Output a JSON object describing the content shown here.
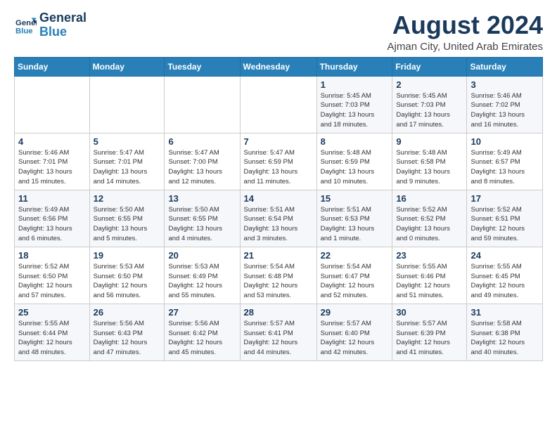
{
  "logo": {
    "line1": "General",
    "line2": "Blue"
  },
  "title": "August 2024",
  "location": "Ajman City, United Arab Emirates",
  "weekdays": [
    "Sunday",
    "Monday",
    "Tuesday",
    "Wednesday",
    "Thursday",
    "Friday",
    "Saturday"
  ],
  "weeks": [
    [
      {
        "day": "",
        "detail": ""
      },
      {
        "day": "",
        "detail": ""
      },
      {
        "day": "",
        "detail": ""
      },
      {
        "day": "",
        "detail": ""
      },
      {
        "day": "1",
        "detail": "Sunrise: 5:45 AM\nSunset: 7:03 PM\nDaylight: 13 hours\nand 18 minutes."
      },
      {
        "day": "2",
        "detail": "Sunrise: 5:45 AM\nSunset: 7:03 PM\nDaylight: 13 hours\nand 17 minutes."
      },
      {
        "day": "3",
        "detail": "Sunrise: 5:46 AM\nSunset: 7:02 PM\nDaylight: 13 hours\nand 16 minutes."
      }
    ],
    [
      {
        "day": "4",
        "detail": "Sunrise: 5:46 AM\nSunset: 7:01 PM\nDaylight: 13 hours\nand 15 minutes."
      },
      {
        "day": "5",
        "detail": "Sunrise: 5:47 AM\nSunset: 7:01 PM\nDaylight: 13 hours\nand 14 minutes."
      },
      {
        "day": "6",
        "detail": "Sunrise: 5:47 AM\nSunset: 7:00 PM\nDaylight: 13 hours\nand 12 minutes."
      },
      {
        "day": "7",
        "detail": "Sunrise: 5:47 AM\nSunset: 6:59 PM\nDaylight: 13 hours\nand 11 minutes."
      },
      {
        "day": "8",
        "detail": "Sunrise: 5:48 AM\nSunset: 6:59 PM\nDaylight: 13 hours\nand 10 minutes."
      },
      {
        "day": "9",
        "detail": "Sunrise: 5:48 AM\nSunset: 6:58 PM\nDaylight: 13 hours\nand 9 minutes."
      },
      {
        "day": "10",
        "detail": "Sunrise: 5:49 AM\nSunset: 6:57 PM\nDaylight: 13 hours\nand 8 minutes."
      }
    ],
    [
      {
        "day": "11",
        "detail": "Sunrise: 5:49 AM\nSunset: 6:56 PM\nDaylight: 13 hours\nand 6 minutes."
      },
      {
        "day": "12",
        "detail": "Sunrise: 5:50 AM\nSunset: 6:55 PM\nDaylight: 13 hours\nand 5 minutes."
      },
      {
        "day": "13",
        "detail": "Sunrise: 5:50 AM\nSunset: 6:55 PM\nDaylight: 13 hours\nand 4 minutes."
      },
      {
        "day": "14",
        "detail": "Sunrise: 5:51 AM\nSunset: 6:54 PM\nDaylight: 13 hours\nand 3 minutes."
      },
      {
        "day": "15",
        "detail": "Sunrise: 5:51 AM\nSunset: 6:53 PM\nDaylight: 13 hours\nand 1 minute."
      },
      {
        "day": "16",
        "detail": "Sunrise: 5:52 AM\nSunset: 6:52 PM\nDaylight: 13 hours\nand 0 minutes."
      },
      {
        "day": "17",
        "detail": "Sunrise: 5:52 AM\nSunset: 6:51 PM\nDaylight: 12 hours\nand 59 minutes."
      }
    ],
    [
      {
        "day": "18",
        "detail": "Sunrise: 5:52 AM\nSunset: 6:50 PM\nDaylight: 12 hours\nand 57 minutes."
      },
      {
        "day": "19",
        "detail": "Sunrise: 5:53 AM\nSunset: 6:50 PM\nDaylight: 12 hours\nand 56 minutes."
      },
      {
        "day": "20",
        "detail": "Sunrise: 5:53 AM\nSunset: 6:49 PM\nDaylight: 12 hours\nand 55 minutes."
      },
      {
        "day": "21",
        "detail": "Sunrise: 5:54 AM\nSunset: 6:48 PM\nDaylight: 12 hours\nand 53 minutes."
      },
      {
        "day": "22",
        "detail": "Sunrise: 5:54 AM\nSunset: 6:47 PM\nDaylight: 12 hours\nand 52 minutes."
      },
      {
        "day": "23",
        "detail": "Sunrise: 5:55 AM\nSunset: 6:46 PM\nDaylight: 12 hours\nand 51 minutes."
      },
      {
        "day": "24",
        "detail": "Sunrise: 5:55 AM\nSunset: 6:45 PM\nDaylight: 12 hours\nand 49 minutes."
      }
    ],
    [
      {
        "day": "25",
        "detail": "Sunrise: 5:55 AM\nSunset: 6:44 PM\nDaylight: 12 hours\nand 48 minutes."
      },
      {
        "day": "26",
        "detail": "Sunrise: 5:56 AM\nSunset: 6:43 PM\nDaylight: 12 hours\nand 47 minutes."
      },
      {
        "day": "27",
        "detail": "Sunrise: 5:56 AM\nSunset: 6:42 PM\nDaylight: 12 hours\nand 45 minutes."
      },
      {
        "day": "28",
        "detail": "Sunrise: 5:57 AM\nSunset: 6:41 PM\nDaylight: 12 hours\nand 44 minutes."
      },
      {
        "day": "29",
        "detail": "Sunrise: 5:57 AM\nSunset: 6:40 PM\nDaylight: 12 hours\nand 42 minutes."
      },
      {
        "day": "30",
        "detail": "Sunrise: 5:57 AM\nSunset: 6:39 PM\nDaylight: 12 hours\nand 41 minutes."
      },
      {
        "day": "31",
        "detail": "Sunrise: 5:58 AM\nSunset: 6:38 PM\nDaylight: 12 hours\nand 40 minutes."
      }
    ]
  ]
}
